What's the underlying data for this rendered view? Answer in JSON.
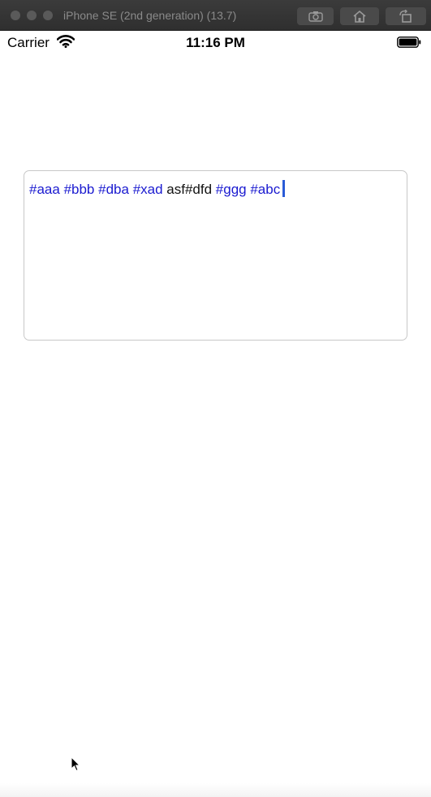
{
  "window": {
    "title": "iPhone SE (2nd generation) (13.7)",
    "toolbar": {
      "screenshot_icon": "camera-icon",
      "home_icon": "home-icon",
      "rotate_icon": "rotate-icon"
    }
  },
  "status_bar": {
    "carrier": "Carrier",
    "wifi_icon": "wifi-icon",
    "time": "11:16 PM",
    "battery_icon": "battery-icon"
  },
  "text_view": {
    "tokens": [
      {
        "text": "#aaa",
        "type": "hashtag"
      },
      {
        "text": " ",
        "type": "plain"
      },
      {
        "text": "#bbb",
        "type": "hashtag"
      },
      {
        "text": " ",
        "type": "plain"
      },
      {
        "text": "#dba",
        "type": "hashtag"
      },
      {
        "text": " ",
        "type": "plain"
      },
      {
        "text": "#xad",
        "type": "hashtag"
      },
      {
        "text": " asf#dfd ",
        "type": "plain"
      },
      {
        "text": "#ggg",
        "type": "hashtag"
      },
      {
        "text": " ",
        "type": "plain"
      },
      {
        "text": "#abc",
        "type": "hashtag"
      }
    ],
    "hashtag_color": "#1a1ad0",
    "text_color": "#111111",
    "caret_color": "#2a5bd7"
  }
}
